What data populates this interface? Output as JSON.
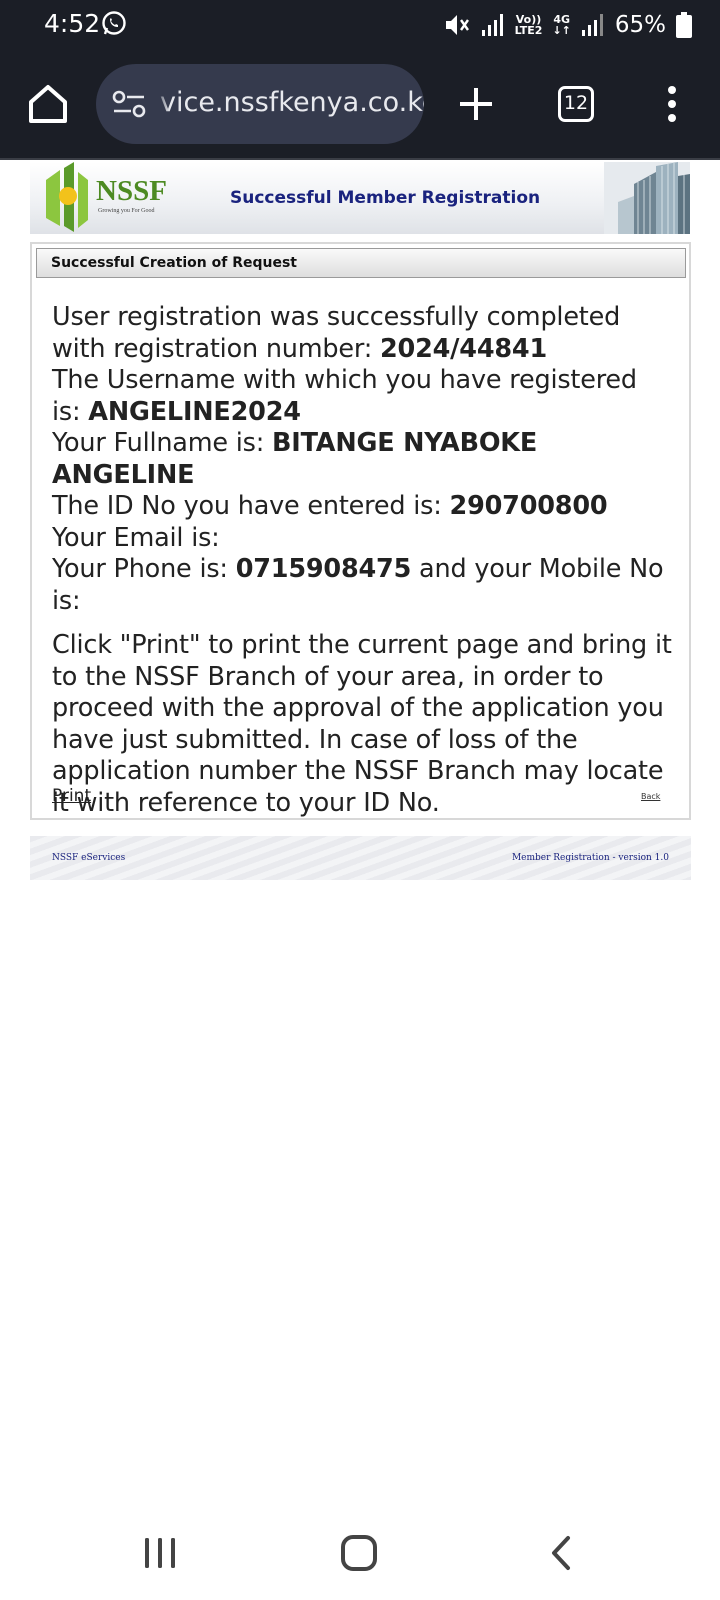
{
  "status_bar": {
    "time": "4:52",
    "network_top": "Vo))",
    "network_bottom": "LTE2",
    "network_type": "4G",
    "battery_percent": "65%",
    "icons": [
      "whatsapp-icon",
      "mute-icon",
      "signal-icon",
      "signal-icon",
      "battery-icon"
    ]
  },
  "browser": {
    "url": "vice.nssfkenya.co.ke",
    "tab_count": "12",
    "icons": [
      "home-icon",
      "site-info-icon",
      "plus-icon",
      "tab-switcher-icon",
      "more-vert-icon"
    ]
  },
  "site": {
    "logo_text": "NSSF",
    "logo_tagline": "Growing you For Good",
    "header_title": "Successful Member Registration"
  },
  "panel": {
    "heading": "Successful Creation of Request",
    "line1_prefix": "User registration was successfully completed with registration number: ",
    "registration_number": "2024/44841",
    "line2_prefix": "The Username with which you have registered is: ",
    "username": "ANGELINE2024",
    "line3_prefix": "Your Fullname is: ",
    "fullname": "BITANGE NYABOKE ANGELINE",
    "line4_prefix": "The ID No you have entered is: ",
    "id_no": "290700800",
    "line5": "Your Email is:",
    "line6_prefix": "Your Phone is: ",
    "phone": "0715908475",
    "line6_suffix": " and your Mobile No is:",
    "instructions": "Click \"Print\" to print the current page and bring it to the NSSF Branch of your area, in order to proceed with the approval of the application you have just submitted. In case of loss of the application number the NSSF Branch may locate it with reference to your ID No.",
    "print_label": "Print",
    "back_label": "Back"
  },
  "footer": {
    "left": "NSSF eServices",
    "right": "Member Registration - version 1.0"
  },
  "nav_bar": {
    "icons": [
      "recents-icon",
      "home-icon",
      "back-icon"
    ]
  },
  "colors": {
    "status_bar_bg": "#1b1e26",
    "url_bar_bg": "#353a4d",
    "header_title": "#1a237e",
    "logo_green": "#5a9a2a",
    "logo_yellow": "#f2c21b"
  }
}
